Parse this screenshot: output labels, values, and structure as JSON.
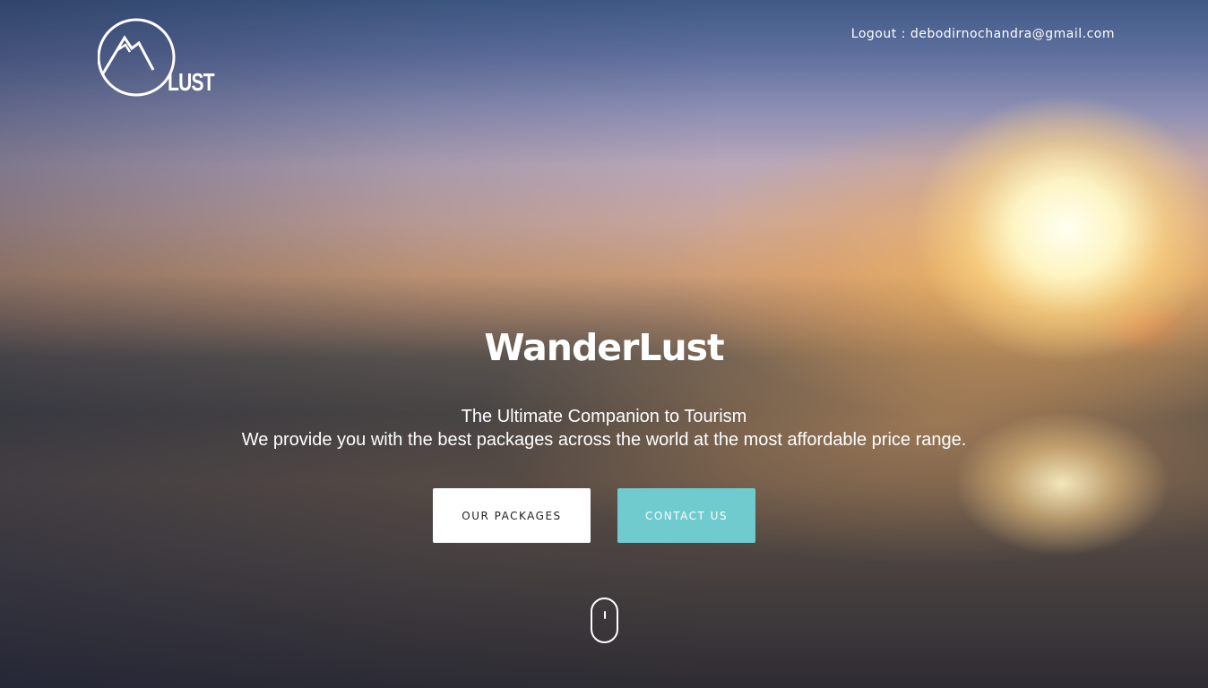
{
  "header": {
    "logo": {
      "icon": "mountain-circle-icon",
      "text": "LUST"
    },
    "user_link": "Logout : debodirnochandra@gmail.com"
  },
  "hero": {
    "title": "WanderLust",
    "tagline_line1": "The Ultimate Companion to Tourism",
    "tagline_line2": "We provide you with the best packages across the world at the most affordable price range.",
    "buttons": {
      "packages_label": "OUR PACKAGES",
      "contact_label": "CONTACT US"
    },
    "scroll_indicator": {
      "icon": "mouse-scroll-icon"
    }
  },
  "colors": {
    "text": "#ffffff",
    "primary_button_bg": "#ffffff",
    "accent_button_bg": "#70cbcf"
  }
}
